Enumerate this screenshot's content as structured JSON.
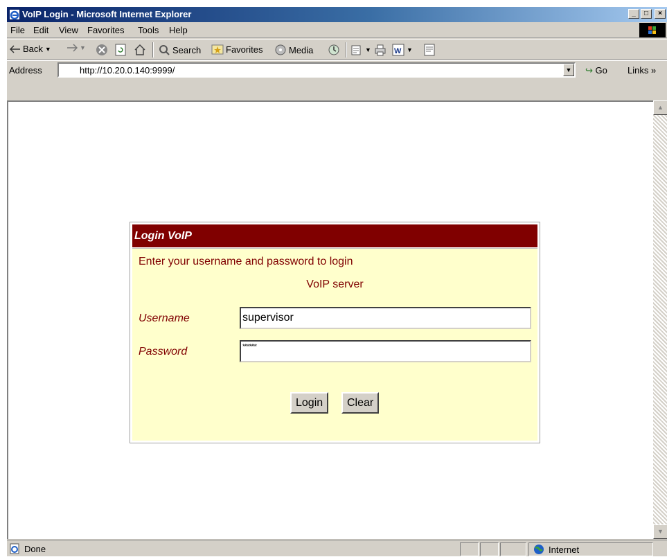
{
  "window": {
    "title": "VoIP Login - Microsoft Internet Explorer",
    "controls": {
      "minimize": "_",
      "maximize": "□",
      "close": "×"
    }
  },
  "menu": [
    "File",
    "Edit",
    "View",
    "Favorites",
    "Tools",
    "Help"
  ],
  "toolbar": {
    "back": "Back",
    "search": "Search",
    "favorites": "Favorites",
    "media": "Media"
  },
  "address": {
    "label": "Address",
    "url": "http://10.20.0.140:9999/",
    "go": "Go",
    "links": "Links »"
  },
  "login": {
    "header": "Login VoIP",
    "prompt": "Enter your username and password to login",
    "server": "VoIP server",
    "username_label": "Username",
    "username_value": "supervisor",
    "password_label": "Password",
    "password_value": "********",
    "login_button": "Login",
    "clear_button": "Clear"
  },
  "status": {
    "text": "Done",
    "zone": "Internet"
  },
  "colors": {
    "header_bg": "#800000",
    "form_bg": "#ffffcc",
    "label_color": "#800000",
    "titlebar": "#0a246a"
  },
  "icons": {
    "title": "ie-icon",
    "status": "page-done-icon",
    "zone": "globe-icon"
  }
}
